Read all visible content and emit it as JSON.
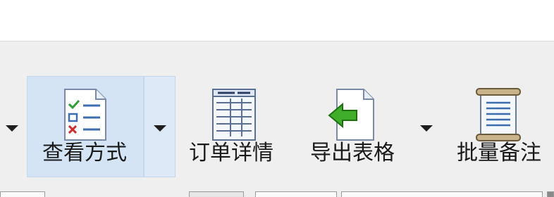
{
  "toolbar": {
    "buttons": [
      {
        "label": "查看方式",
        "icon": "checklist-document-icon",
        "has_dropdown": true
      },
      {
        "label": "订单详情",
        "icon": "order-table-icon",
        "has_dropdown": false
      },
      {
        "label": "导出表格",
        "icon": "export-document-icon",
        "has_dropdown": true
      },
      {
        "label": "批量备注",
        "icon": "scroll-notes-icon",
        "has_dropdown": false
      }
    ]
  },
  "colors": {
    "active_background": "#d4e4f5",
    "active_border": "#c3d7ee",
    "export_arrow": "#3fae2a",
    "doc_blue": "#3d6fb0"
  }
}
